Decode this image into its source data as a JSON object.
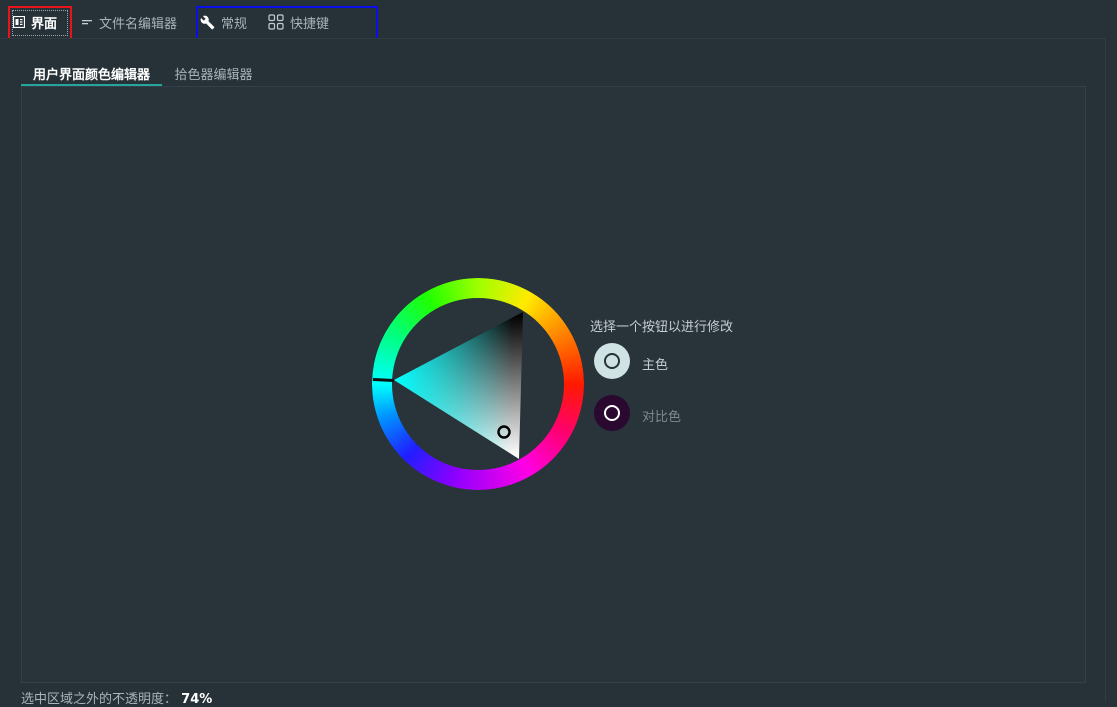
{
  "top_tabs": [
    {
      "label": "界面",
      "icon": "interface-icon"
    },
    {
      "label": "文件名编辑器",
      "icon": "short-text-icon"
    },
    {
      "label": "常规",
      "icon": "wrench-icon"
    },
    {
      "label": "快捷键",
      "icon": "grid-icon"
    }
  ],
  "sub_tabs": [
    {
      "label": "用户界面颜色编辑器"
    },
    {
      "label": "拾色器编辑器"
    }
  ],
  "color_editor": {
    "instruction": "选择一个按钮以进行修改",
    "primary_label": "主色",
    "contrast_label": "对比色",
    "primary_color": "#cfe3e4",
    "contrast_color": "#2a0830",
    "selected_hue": "#00ffff"
  },
  "footer": {
    "opacity_label": "选中区域之外的不透明度：",
    "opacity_value": "74%"
  },
  "colors": {
    "background": "#263238",
    "accent": "#26a69a",
    "highlight_red": "#e8131b",
    "highlight_blue": "#0a0ee8"
  }
}
